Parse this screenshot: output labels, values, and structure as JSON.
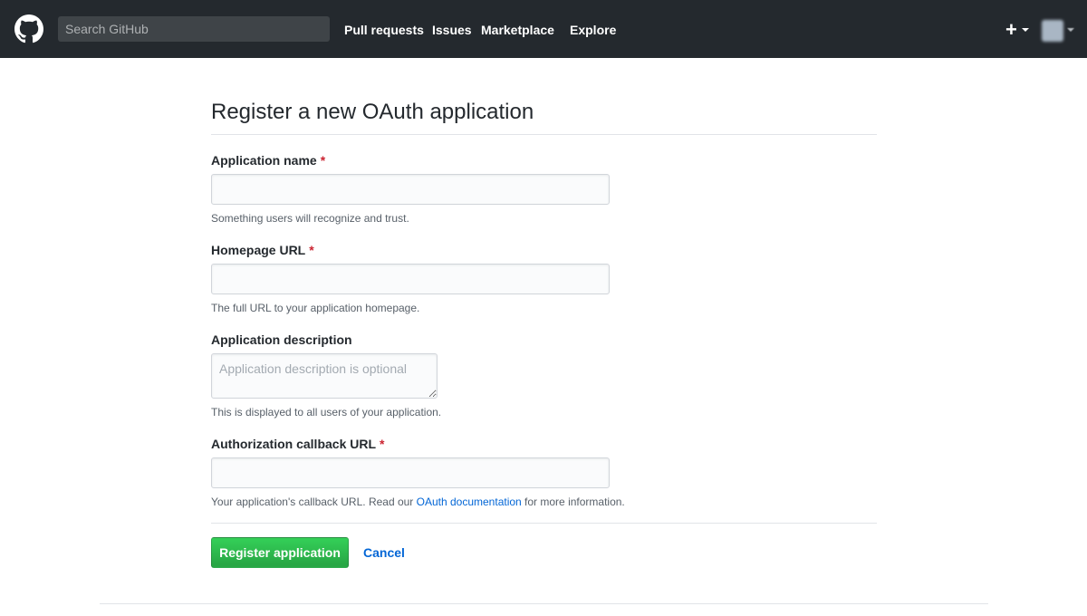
{
  "header": {
    "search_placeholder": "Search GitHub",
    "nav": {
      "pull_requests": "Pull requests",
      "issues": "Issues",
      "marketplace": "Marketplace",
      "explore": "Explore"
    },
    "plus_icon": "+",
    "background_color": "#24292e"
  },
  "form": {
    "title": "Register a new OAuth application",
    "required_marker": "*",
    "app_name": {
      "label": "Application name",
      "value": "",
      "note": "Something users will recognize and trust."
    },
    "homepage": {
      "label": "Homepage URL",
      "value": "",
      "note": "The full URL to your application homepage."
    },
    "description": {
      "label": "Application description",
      "placeholder": "Application description is optional",
      "note": "This is displayed to all users of your application."
    },
    "callback": {
      "label": "Authorization callback URL",
      "value": "",
      "note_before": "Your application's callback URL. Read our ",
      "note_link": "OAuth documentation",
      "note_after": " for more information."
    },
    "submit_label": "Register application",
    "cancel_label": "Cancel"
  },
  "colors": {
    "primary_button": "#28a745",
    "link": "#0366d6",
    "required": "#cb2431"
  },
  "icons": {
    "logo": "github-octocat-icon",
    "plus": "plus-icon",
    "caret": "caret-down-icon"
  }
}
